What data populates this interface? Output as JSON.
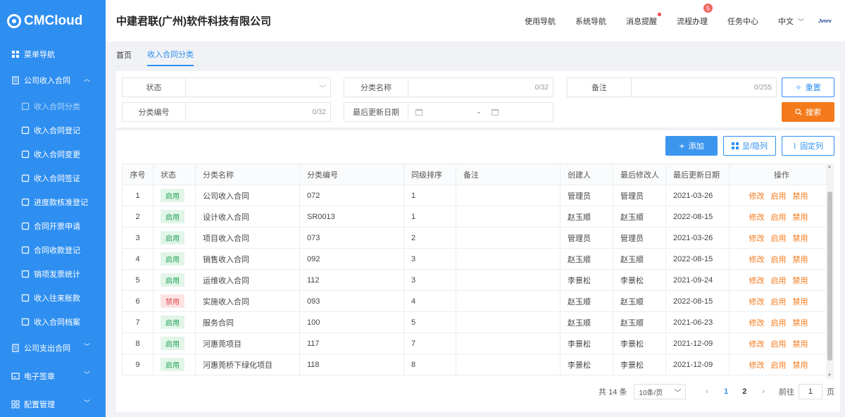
{
  "logo": {
    "text": "CMCloud"
  },
  "header": {
    "company": "中建君联(广州)软件科技有限公司",
    "menu": [
      "使用导航",
      "系统导航",
      "消息提醒",
      "流程办理",
      "任务中心"
    ],
    "process_badge": "5",
    "language": "中文",
    "avatar_text": "Jvnrv"
  },
  "sidebar": {
    "top": "菜单导航",
    "group1": "公司收入合同",
    "items": [
      "收入合同分类",
      "收入合同登记",
      "收入合同变更",
      "收入合同签证",
      "进度款核准登记",
      "合同开票申请",
      "合同收款登记",
      "销项发票统计",
      "收入往来账款",
      "收入合同档案"
    ],
    "group2": "公司支出合同",
    "group3": "电子签章",
    "group4": "配置管理"
  },
  "tabs": [
    "首页",
    "收入合同分类"
  ],
  "filter": {
    "status_label": "状态",
    "name_label": "分类名称",
    "name_count": "0/32",
    "remark_label": "备注",
    "remark_count": "0/255",
    "code_label": "分类编号",
    "code_count": "0/32",
    "date_label": "最后更新日期",
    "date_sep": "-",
    "reset": "重置",
    "search": "搜索"
  },
  "toolbar": {
    "add": "添加",
    "toggle_cols": "显/隐列",
    "fix_cols": "固定列"
  },
  "table": {
    "headers": [
      "序号",
      "状态",
      "分类名称",
      "分类编号",
      "同级排序",
      "备注",
      "创建人",
      "最后修改人",
      "最后更新日期",
      "操作"
    ],
    "ops": [
      "修改",
      "启用",
      "禁用"
    ],
    "rows": [
      {
        "no": "1",
        "status": "启用",
        "active": true,
        "name": "公司收入合同",
        "code": "072",
        "sort": "1",
        "remark": "",
        "creator": "管理员",
        "modifier": "管理员",
        "date": "2021-03-26"
      },
      {
        "no": "2",
        "status": "启用",
        "active": true,
        "name": "设计收入合同",
        "code": "SR0013",
        "sort": "1",
        "remark": "",
        "creator": "赵玉顺",
        "modifier": "赵玉顺",
        "date": "2022-08-15"
      },
      {
        "no": "3",
        "status": "启用",
        "active": true,
        "name": "项目收入合同",
        "code": "073",
        "sort": "2",
        "remark": "",
        "creator": "管理员",
        "modifier": "管理员",
        "date": "2021-03-26"
      },
      {
        "no": "4",
        "status": "启用",
        "active": true,
        "name": "销售收入合同",
        "code": "092",
        "sort": "3",
        "remark": "",
        "creator": "赵玉顺",
        "modifier": "赵玉顺",
        "date": "2022-08-15"
      },
      {
        "no": "5",
        "status": "启用",
        "active": true,
        "name": "运维收入合同",
        "code": "112",
        "sort": "3",
        "remark": "",
        "creator": "李景松",
        "modifier": "李景松",
        "date": "2021-09-24"
      },
      {
        "no": "6",
        "status": "禁用",
        "active": false,
        "name": "实施收入合同",
        "code": "093",
        "sort": "4",
        "remark": "",
        "creator": "赵玉顺",
        "modifier": "赵玉顺",
        "date": "2022-08-15"
      },
      {
        "no": "7",
        "status": "启用",
        "active": true,
        "name": "服务合同",
        "code": "100",
        "sort": "5",
        "remark": "",
        "creator": "赵玉顺",
        "modifier": "赵玉顺",
        "date": "2021-06-23"
      },
      {
        "no": "8",
        "status": "启用",
        "active": true,
        "name": "河惠莞项目",
        "code": "117",
        "sort": "7",
        "remark": "",
        "creator": "李景松",
        "modifier": "李景松",
        "date": "2021-12-09"
      },
      {
        "no": "9",
        "status": "启用",
        "active": true,
        "name": "河惠莞桥下绿化项目",
        "code": "118",
        "sort": "8",
        "remark": "",
        "creator": "李景松",
        "modifier": "李景松",
        "date": "2021-12-09"
      }
    ]
  },
  "pager": {
    "total": "共 14 条",
    "page_size": "10条/页",
    "pages": [
      "1",
      "2"
    ],
    "jump_prefix": "前往",
    "jump_value": "1",
    "jump_suffix": "页"
  },
  "colors": {
    "sidebar": "#2f8ff0",
    "accent": "#2f8ff0",
    "orange": "#f47a1b",
    "enabled": "#23a257",
    "disabled": "#e04848"
  }
}
